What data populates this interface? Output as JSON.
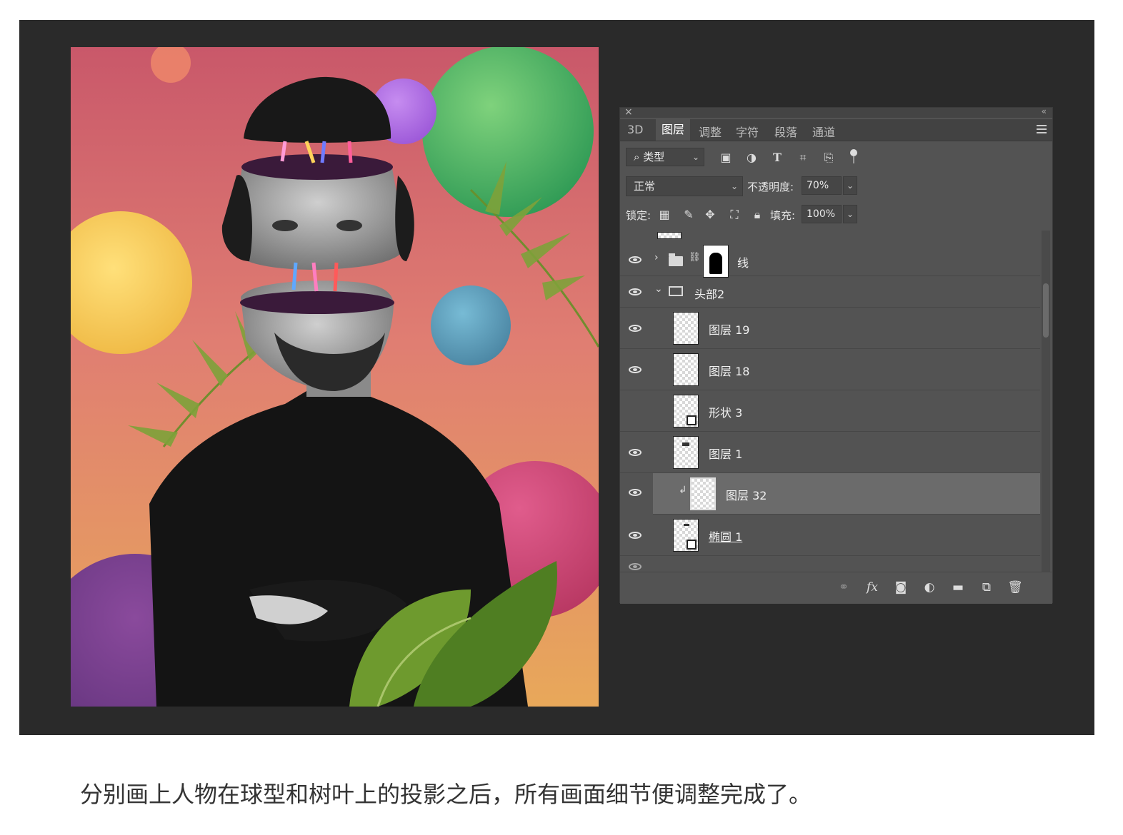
{
  "panel": {
    "tabs": [
      {
        "label": "3D"
      },
      {
        "label": "图层"
      },
      {
        "label": "调整"
      },
      {
        "label": "字符"
      },
      {
        "label": "段落"
      },
      {
        "label": "通道"
      }
    ],
    "active_tab": "图层",
    "filter": {
      "label": "类型",
      "icons": [
        "image-filter-icon",
        "adjustment-filter-icon",
        "text-filter-icon",
        "shape-filter-icon",
        "smart-object-filter-icon",
        "filter-toggle-icon"
      ]
    },
    "blend_mode": "正常",
    "opacity_label": "不透明度:",
    "opacity_value": "70%",
    "lock_label": "锁定:",
    "fill_label": "填充:",
    "fill_value": "100%",
    "layers": [
      {
        "name": "线",
        "type": "group",
        "collapsed": true,
        "visible": true
      },
      {
        "name": "头部2",
        "type": "group",
        "collapsed": false,
        "visible": true
      },
      {
        "name": "图层 19",
        "type": "pixel",
        "visible": true
      },
      {
        "name": "图层 18",
        "type": "pixel",
        "visible": true
      },
      {
        "name": "形状 3",
        "type": "shape",
        "visible": false
      },
      {
        "name": "图层 1",
        "type": "pixel",
        "visible": true
      },
      {
        "name": "图层 32",
        "type": "pixel",
        "visible": true,
        "clipped": true,
        "selected": true
      },
      {
        "name": "椭圆 1",
        "type": "shape",
        "visible": true
      }
    ],
    "bottom_icons": [
      "link-layers-icon",
      "fx-icon",
      "layer-mask-icon",
      "adjustment-layer-icon",
      "new-group-icon",
      "new-layer-icon",
      "delete-layer-icon"
    ]
  },
  "caption": "分别画上人物在球型和树叶上的投影之后，所有画面细节便调整完成了。",
  "colors": {
    "stage": "#2a2a2a",
    "panel": "#535353",
    "selected_row": "#6b6b6b"
  }
}
